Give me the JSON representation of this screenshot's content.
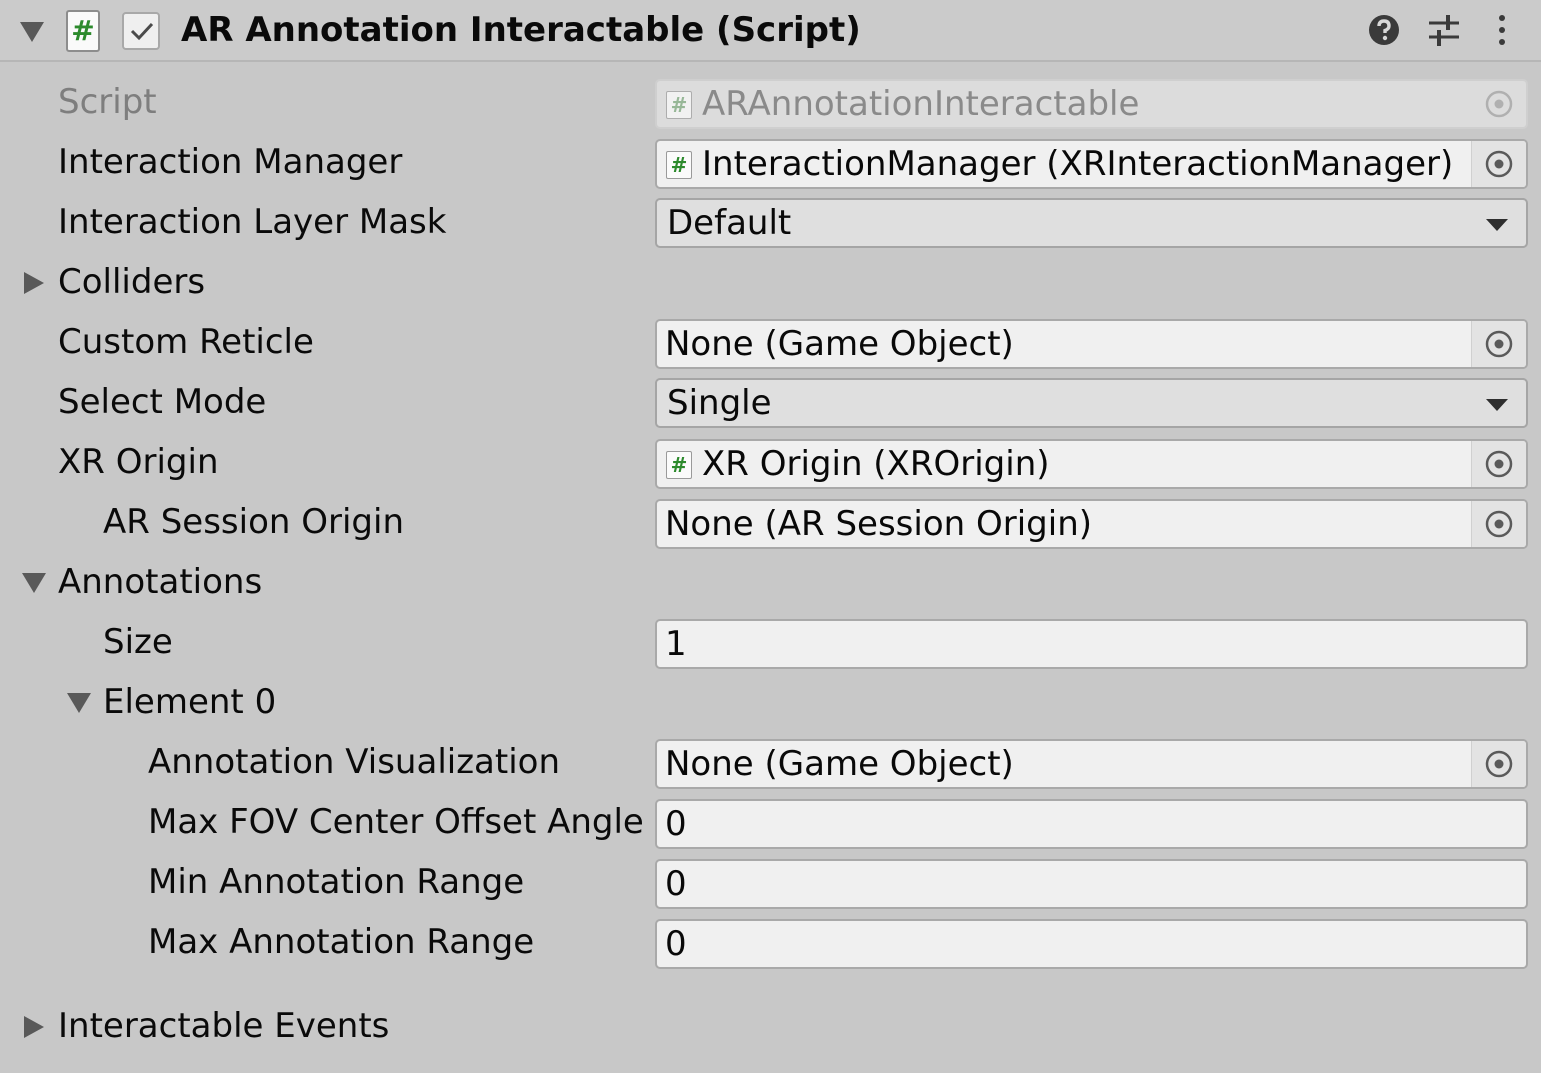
{
  "header": {
    "title": "AR Annotation Interactable (Script)",
    "script_icon_glyph": "#",
    "enabled": true,
    "icons": [
      "help-icon",
      "presets-icon",
      "more-menu-icon"
    ]
  },
  "properties": {
    "script": {
      "label": "Script",
      "value": "ARAnnotationInteractable"
    },
    "interaction_manager": {
      "label": "Interaction Manager",
      "value": "InteractionManager (XRInteractionManager)"
    },
    "interaction_layer_mask": {
      "label": "Interaction Layer Mask",
      "value": "Default"
    },
    "colliders": {
      "label": "Colliders"
    },
    "custom_reticle": {
      "label": "Custom Reticle",
      "value": "None (Game Object)"
    },
    "select_mode": {
      "label": "Select Mode",
      "value": "Single"
    },
    "xr_origin": {
      "label": "XR Origin",
      "value": "XR Origin (XROrigin)"
    },
    "ar_session_origin": {
      "label": "AR Session Origin",
      "value": "None (AR Session Origin)"
    },
    "annotations": {
      "label": "Annotations",
      "size": {
        "label": "Size",
        "value": "1"
      },
      "element0": {
        "label": "Element 0",
        "annotation_visualization": {
          "label": "Annotation Visualization",
          "value": "None (Game Object)"
        },
        "max_fov_center_offset_angle": {
          "label": "Max FOV Center Offset Angle",
          "value": "0"
        },
        "min_annotation_range": {
          "label": "Min Annotation Range",
          "value": "0"
        },
        "max_annotation_range": {
          "label": "Max Annotation Range",
          "value": "0"
        }
      }
    },
    "interactable_events": {
      "label": "Interactable Events"
    }
  }
}
